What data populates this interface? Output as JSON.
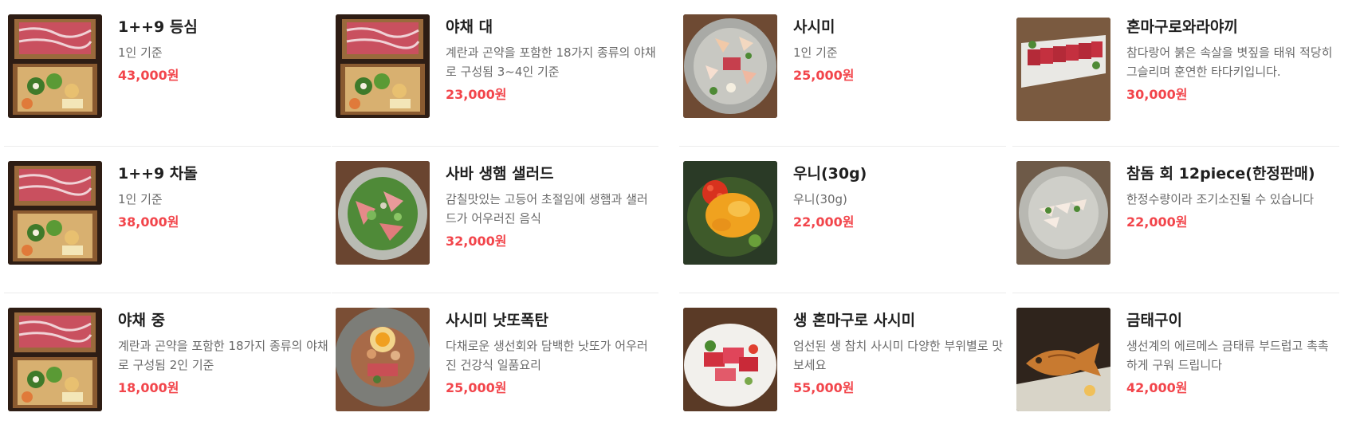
{
  "menu": {
    "columns": [
      {
        "items": [
          {
            "name": "1++9 등심",
            "desc": "1인 기준",
            "price": "43,000원",
            "image": "beef-box"
          },
          {
            "name": "1++9 차돌",
            "desc": "1인 기준",
            "price": "38,000원",
            "image": "beef-box"
          },
          {
            "name": "야채 중",
            "desc": "계란과 곤약을 포함한 18가지 종류의 야채로 구성됨 2인 기준",
            "price": "18,000원",
            "image": "beef-box"
          }
        ]
      },
      {
        "items": [
          {
            "name": "야채 대",
            "desc": "계란과 곤약을 포함한 18가지 종류의 야채로 구성됨 3~4인 기준",
            "price": "23,000원",
            "image": "beef-box"
          },
          {
            "name": "사바 생햄 샐러드",
            "desc": "감칠맛있는 고등어 초절임에 생햄과 샐러드가 어우러진 음식",
            "price": "32,000원",
            "image": "salad-plate"
          },
          {
            "name": "사시미 낫또폭탄",
            "desc": "다채로운 생선회와 담백한 낫또가 어우러진 건강식 일품요리",
            "price": "25,000원",
            "image": "natto-plate"
          }
        ]
      },
      {
        "items": [
          {
            "name": "사시미",
            "desc": "1인 기준",
            "price": "25,000원",
            "image": "sashimi-plate"
          },
          {
            "name": "우니(30g)",
            "desc": "우니(30g)",
            "price": "22,000원",
            "image": "uni-dish"
          },
          {
            "name": "생 혼마구로 사시미",
            "desc": "엄선된 생 참치 사시미 다양한 부위별로 맛보세요",
            "price": "55,000원",
            "image": "tuna-plate"
          }
        ]
      },
      {
        "items": [
          {
            "name": "혼마구로와라야끼",
            "desc": "참다랑어 붉은 속살을 볏짚을 태워 적당히 그슬리며 훈연한 타다키입니다.",
            "price": "30,000원",
            "image": "tataki-plate"
          },
          {
            "name": "참돔 회 12piece(한정판매)",
            "desc": "한정수량이라 조기소진될 수 있습니다",
            "price": "22,000원",
            "image": "snapper-plate"
          },
          {
            "name": "금태구이",
            "desc": "생선계의 에르메스 금태류 부드럽고 촉촉하게 구워 드립니다",
            "price": "42,000원",
            "image": "grilled-fish"
          }
        ]
      }
    ]
  }
}
